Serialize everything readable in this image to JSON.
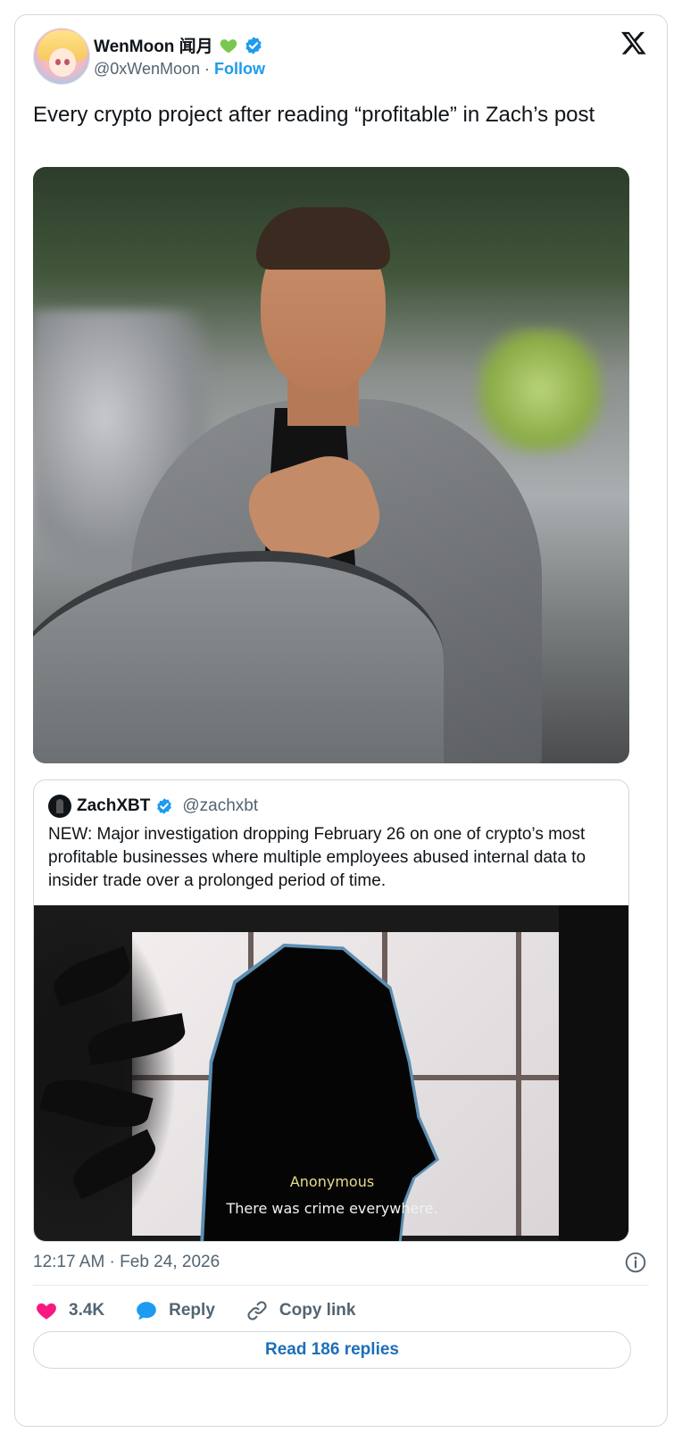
{
  "author": {
    "display_name": "WenMoon 闻月",
    "handle": "@0xWenMoon",
    "separator": "·",
    "follow_label": "Follow"
  },
  "tweet": {
    "text": "Every crypto project after reading “profitable” in Zach’s post"
  },
  "quoted": {
    "display_name": "ZachXBT",
    "handle": "@zachxbt",
    "text": "NEW: Major investigation dropping February 26 on one of crypto’s most profitable businesses where multiple employees abused internal data to insider trade over a prolonged period of time.",
    "image_caption_speaker": "Anonymous",
    "image_caption_line": "There was crime everywhere."
  },
  "meta": {
    "timestamp": "12:17 AM · Feb 24, 2026"
  },
  "actions": {
    "likes": "3.4K",
    "reply_label": "Reply",
    "copy_label": "Copy link"
  },
  "read_replies_label": "Read 186 replies",
  "colors": {
    "accent": "#1d9bf0",
    "like": "#f91880",
    "muted": "#536471",
    "green_heart": "#7ac74f"
  },
  "icons": [
    "verified-badge-icon",
    "green-heart-icon",
    "x-logo-icon",
    "info-icon",
    "heart-icon",
    "reply-bubble-icon",
    "link-icon"
  ]
}
